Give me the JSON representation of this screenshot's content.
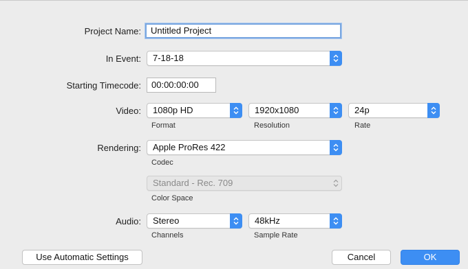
{
  "labels": {
    "project_name": "Project Name:",
    "in_event": "In Event:",
    "starting_timecode": "Starting Timecode:",
    "video": "Video:",
    "rendering": "Rendering:",
    "audio": "Audio:"
  },
  "fields": {
    "project_name": "Untitled Project",
    "starting_timecode": "00:00:00:00"
  },
  "popups": {
    "in_event": "7-18-18",
    "video_format": "1080p HD",
    "video_resolution": "1920x1080",
    "video_rate": "24p",
    "codec": "Apple ProRes 422",
    "color_space": "Standard - Rec. 709",
    "audio_channels": "Stereo",
    "audio_sample_rate": "48kHz"
  },
  "sublabels": {
    "format": "Format",
    "resolution": "Resolution",
    "rate": "Rate",
    "codec": "Codec",
    "color_space": "Color Space",
    "channels": "Channels",
    "sample_rate": "Sample Rate"
  },
  "buttons": {
    "use_automatic": "Use Automatic Settings",
    "cancel": "Cancel",
    "ok": "OK"
  },
  "colors": {
    "accent": "#3d8ef3",
    "panel_bg": "#ececec"
  },
  "icons": {
    "popup_arrows": "chevron-up-down-icon"
  }
}
